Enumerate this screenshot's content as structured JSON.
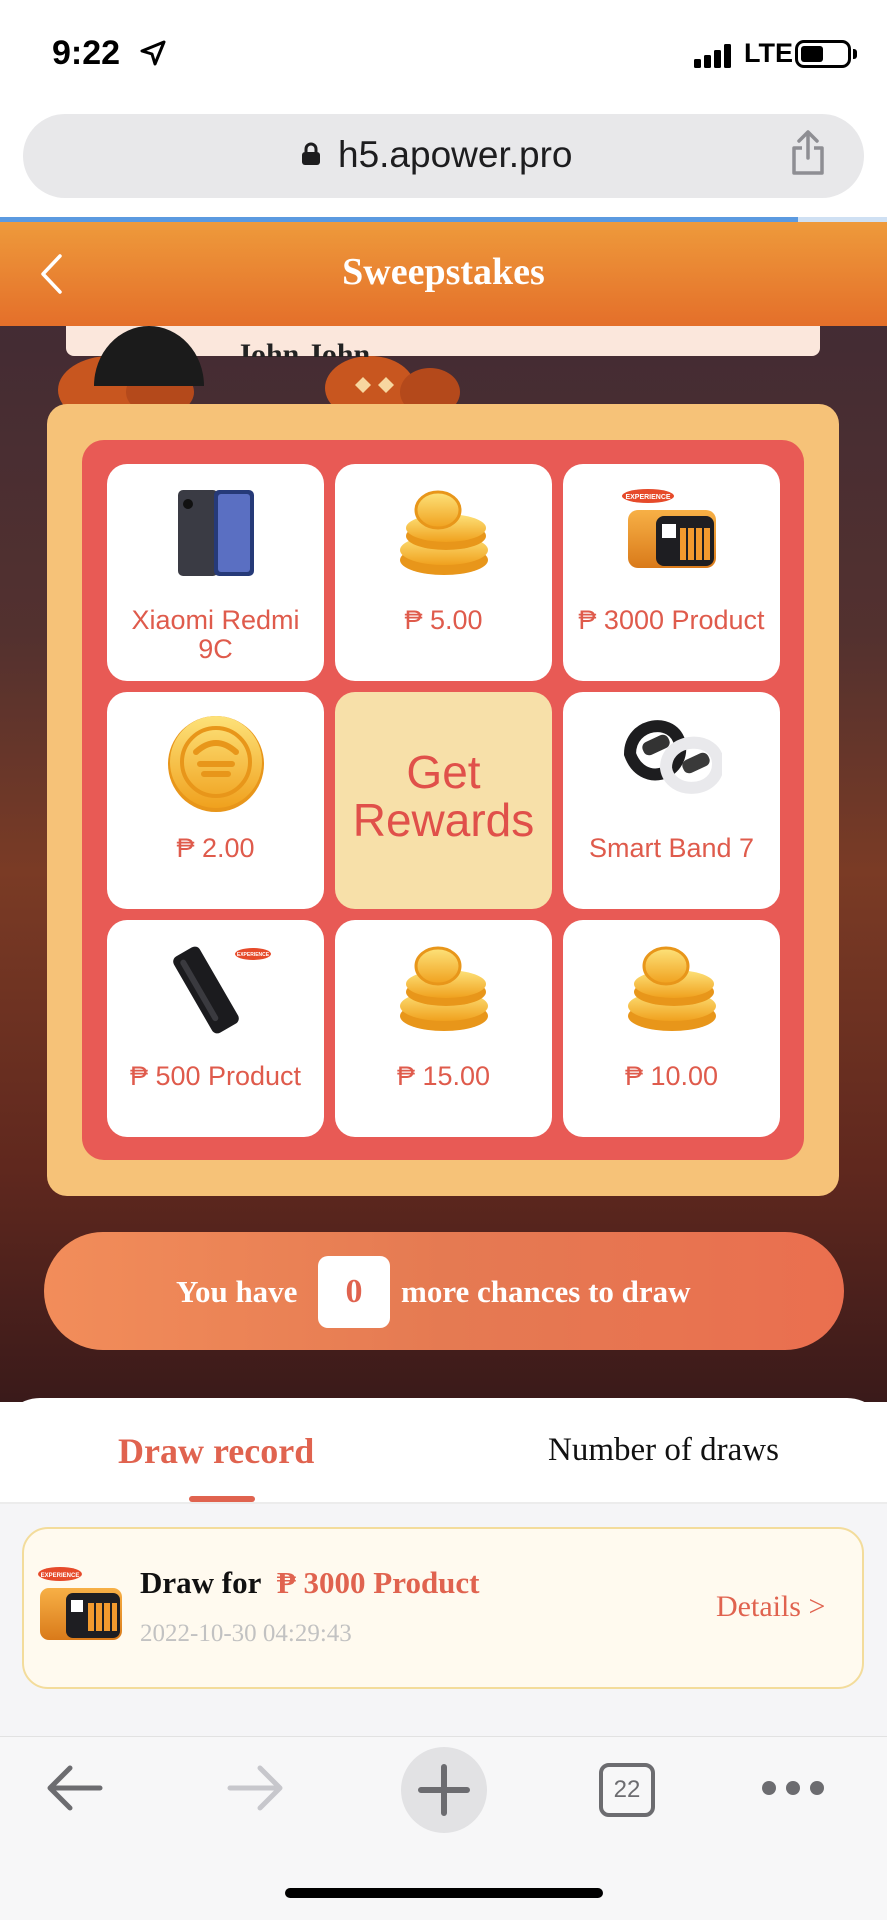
{
  "status_bar": {
    "time": "9:22",
    "network": "LTE",
    "battery_level": 0.45
  },
  "browser": {
    "url": "h5.apower.pro",
    "load_progress": 0.9,
    "tab_count": "22"
  },
  "header": {
    "title": "Sweepstakes"
  },
  "ticker": {
    "winner_name": "John John"
  },
  "prizes": [
    {
      "label": "Xiaomi Redmi 9C",
      "icon": "phone-icon"
    },
    {
      "label": "₱ 5.00",
      "icon": "coins-icon"
    },
    {
      "label": "₱ 3000 Product",
      "icon": "power-station-icon"
    },
    {
      "label": "₱ 2.00",
      "icon": "coin-icon"
    },
    {
      "label": "Get Rewards"
    },
    {
      "label": "Smart Band 7",
      "icon": "smart-band-icon"
    },
    {
      "label": "₱ 500 Product",
      "icon": "power-bank-icon"
    },
    {
      "label": "₱ 15.00",
      "icon": "coins-icon"
    },
    {
      "label": "₱ 10.00",
      "icon": "coins-icon"
    }
  ],
  "badge_text": "EXPERIENCE",
  "chances": {
    "prefix": "You have",
    "count": "0",
    "suffix": "more chances to draw"
  },
  "tabs": {
    "draw_record": "Draw record",
    "number_of_draws": "Number of draws"
  },
  "record": {
    "prefix": "Draw for",
    "prize": "₱ 3000 Product",
    "timestamp": "2022-10-30 04:29:43",
    "details": "Details >"
  },
  "colors": {
    "accent": "#e0634f",
    "header_orange": "#e9822f",
    "board_red": "#e85a55",
    "board_frame": "#f6c278",
    "link_blue": "#5b9ae0"
  }
}
